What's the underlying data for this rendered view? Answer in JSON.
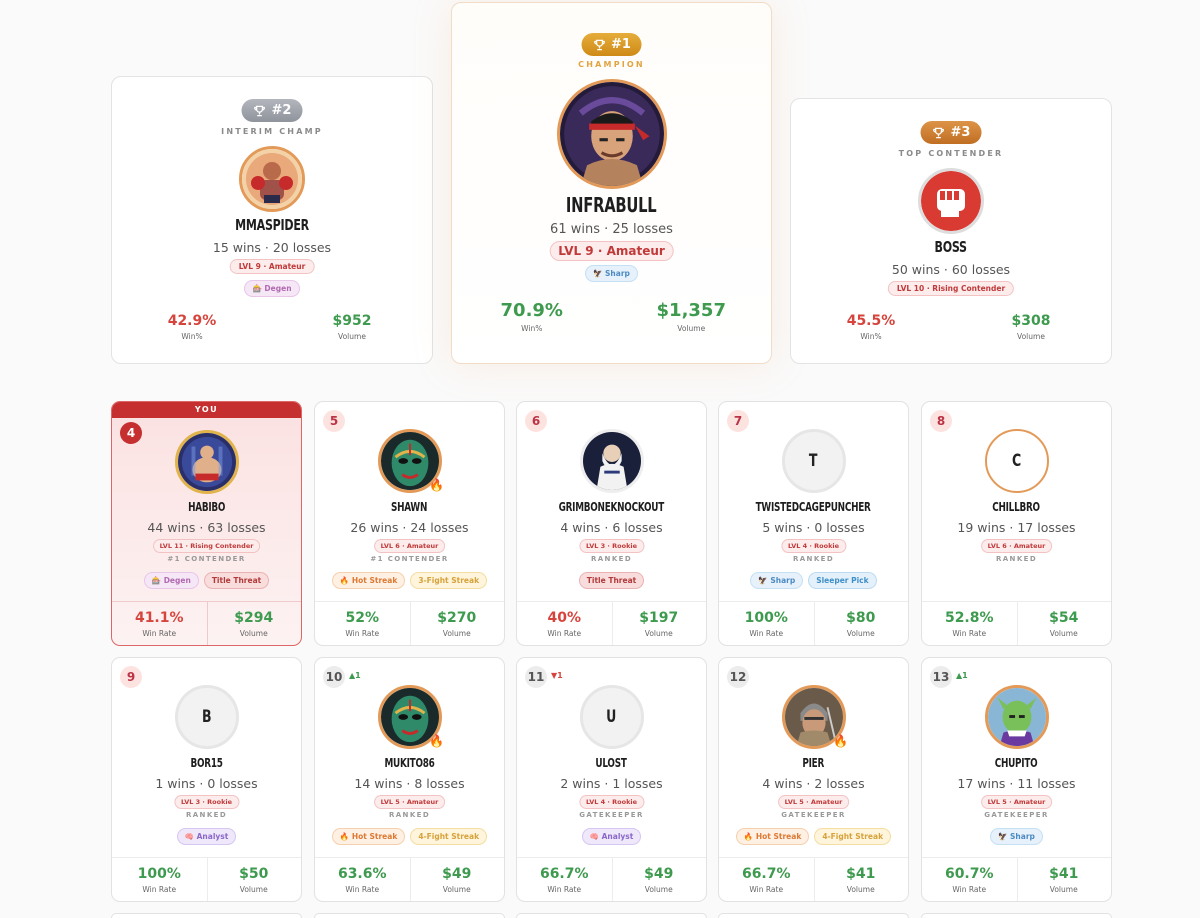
{
  "podium": [
    {
      "rank": "#2",
      "title": "INTERIM CHAMP",
      "name": "MMASPIDER",
      "record": "15 wins · 20 losses",
      "level": "LVL 9 · Amateur",
      "tags": [
        "Degen"
      ],
      "win_pct": "42.9%",
      "win_label": "Win%",
      "volume": "$952",
      "volume_label": "Volume",
      "avatar_icon": "boxer-avatar"
    },
    {
      "rank": "#1",
      "title": "CHAMPION",
      "name": "INFRABULL",
      "record": "61 wins · 25 losses",
      "level": "LVL 9 · Amateur",
      "tags": [
        "Sharp"
      ],
      "win_pct": "70.9%",
      "win_label": "Win%",
      "volume": "$1,357",
      "volume_label": "Volume",
      "avatar_icon": "fighter-headband-avatar"
    },
    {
      "rank": "#3",
      "title": "TOP CONTENDER",
      "name": "BOSS",
      "record": "50 wins · 60 losses",
      "level": "LVL 10 · Rising Contender",
      "tags": [],
      "win_pct": "45.5%",
      "win_label": "Win%",
      "volume": "$308",
      "volume_label": "Volume",
      "avatar_icon": "fist-logo-avatar"
    }
  ],
  "you_label": "YOU",
  "stat_labels": {
    "win_rate": "Win Rate",
    "volume": "Volume"
  },
  "cards": [
    {
      "rank": "4",
      "name": "HABIBO",
      "record": "44 wins · 63 losses",
      "level": "LVL 11 · Rising Contender",
      "sub": "#1 CONTENDER",
      "tags": [
        "Degen",
        "Title Threat"
      ],
      "win_rate": "41.1%",
      "volume": "$294",
      "you": true
    },
    {
      "rank": "5",
      "name": "SHAWN",
      "record": "26 wins · 24 losses",
      "level": "LVL 6 · Amateur",
      "sub": "#1 CONTENDER",
      "tags": [
        "Hot Streak",
        "3-Fight Streak"
      ],
      "win_rate": "52%",
      "volume": "$270",
      "fire": true
    },
    {
      "rank": "6",
      "name": "GRIMBONEKNOCKOUT",
      "record": "4 wins · 6 losses",
      "level": "LVL 3 · Rookie",
      "sub": "RANKED",
      "tags": [
        "Title Threat"
      ],
      "win_rate": "40%",
      "volume": "$197"
    },
    {
      "rank": "7",
      "name": "TWISTEDCAGEPUNCHER",
      "record": "5 wins · 0 losses",
      "level": "LVL 4 · Rookie",
      "sub": "RANKED",
      "tags": [
        "Sharp",
        "Sleeper Pick"
      ],
      "win_rate": "100%",
      "volume": "$80",
      "initial": "T"
    },
    {
      "rank": "8",
      "name": "CHILLBRO",
      "record": "19 wins · 17 losses",
      "level": "LVL 6 · Amateur",
      "sub": "RANKED",
      "tags": [],
      "win_rate": "52.8%",
      "volume": "$54",
      "initial": "C"
    },
    {
      "rank": "9",
      "name": "BOR15",
      "record": "1 wins · 0 losses",
      "level": "LVL 3 · Rookie",
      "sub": "RANKED",
      "tags": [
        "Analyst"
      ],
      "win_rate": "100%",
      "volume": "$50",
      "initial": "B"
    },
    {
      "rank": "10",
      "move": "▲1",
      "name": "MUKITO86",
      "record": "14 wins · 8 losses",
      "level": "LVL 5 · Amateur",
      "sub": "RANKED",
      "tags": [
        "Hot Streak",
        "4-Fight Streak"
      ],
      "win_rate": "63.6%",
      "volume": "$49",
      "fire": true
    },
    {
      "rank": "11",
      "move": "▼1",
      "name": "ULOST",
      "record": "2 wins · 1 losses",
      "level": "LVL 4 · Rookie",
      "sub": "GATEKEEPER",
      "tags": [
        "Analyst"
      ],
      "win_rate": "66.7%",
      "volume": "$49",
      "initial": "U"
    },
    {
      "rank": "12",
      "name": "PIER",
      "record": "4 wins · 2 losses",
      "level": "LVL 5 · Amateur",
      "sub": "GATEKEEPER",
      "tags": [
        "Hot Streak",
        "4-Fight Streak"
      ],
      "win_rate": "66.7%",
      "volume": "$41",
      "fire": true
    },
    {
      "rank": "13",
      "move": "▲1",
      "name": "CHUPITO",
      "record": "17 wins · 11 losses",
      "level": "LVL 5 · Amateur",
      "sub": "GATEKEEPER",
      "tags": [
        "Sharp"
      ],
      "win_rate": "60.7%",
      "volume": "$41"
    }
  ]
}
